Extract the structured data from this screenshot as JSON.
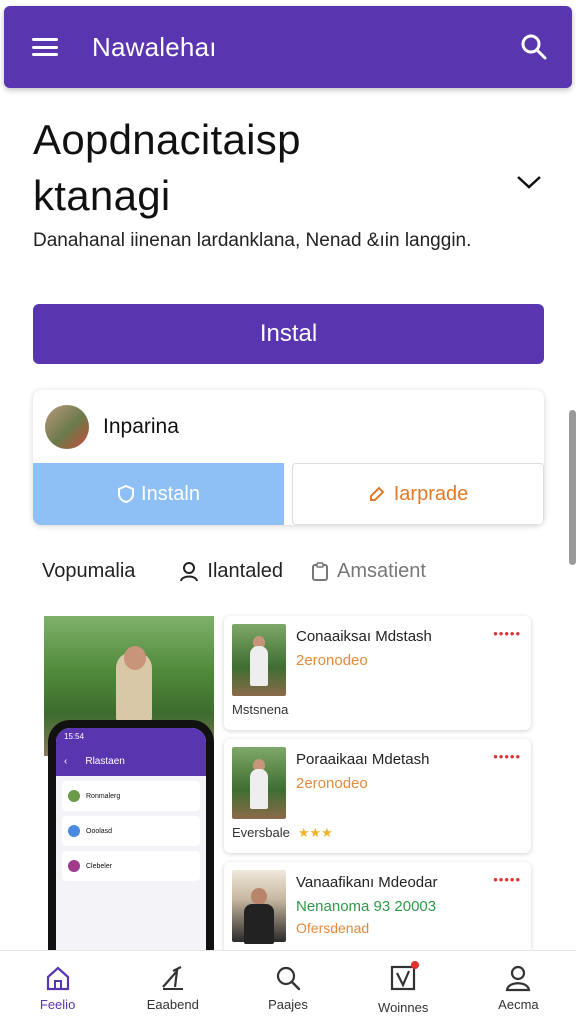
{
  "app_bar": {
    "title": "Nawalehaı",
    "menu_icon": "menu-icon",
    "search_icon": "search-icon",
    "color": "#5a35b0"
  },
  "headline": {
    "line1": "Aopdnacitaisp",
    "line2": "ktanagi"
  },
  "subtitle": "Danahanal iinenan lardanklana, Nenad &ıin langgin.",
  "install_button": {
    "label": "Instal"
  },
  "profile_card": {
    "name": "Inparina",
    "primary_action": "Instaln",
    "secondary_action": "Iarprade"
  },
  "tabs": [
    {
      "label": "Vopumalia"
    },
    {
      "label": "Ilantaled"
    },
    {
      "label": "Amsatient"
    }
  ],
  "phone_screen": {
    "time": "15:54",
    "header": "Rlastaen",
    "items": [
      "Ronmalerg",
      "Ooolasd",
      "Clebeler"
    ]
  },
  "list_items": [
    {
      "title": "Conaaiksaı Mdstash",
      "subtitle": "2eronodeo",
      "dots": "•••••",
      "caption": "Mstsnena",
      "stars": ""
    },
    {
      "title": "Poraaikaaı Mdetash",
      "subtitle": "2eronodeo",
      "dots": "•••••",
      "caption": "Eversbale",
      "stars": "★★★"
    },
    {
      "title": "Vanaafikanı Mdeodar",
      "subtitle": "Nenanoma 93 20003",
      "dots": "•••••",
      "caption": "Ofersdenad",
      "stars": ""
    }
  ],
  "bottom_nav": [
    {
      "label": "Feelio",
      "icon": "home-icon",
      "active": true
    },
    {
      "label": "Eaabend",
      "icon": "trend-icon",
      "active": false
    },
    {
      "label": "Paajes",
      "icon": "search-icon",
      "active": false
    },
    {
      "label": "Woinnes",
      "icon": "notification-icon",
      "active": false
    },
    {
      "label": "Aecma",
      "icon": "profile-icon",
      "active": false
    }
  ]
}
